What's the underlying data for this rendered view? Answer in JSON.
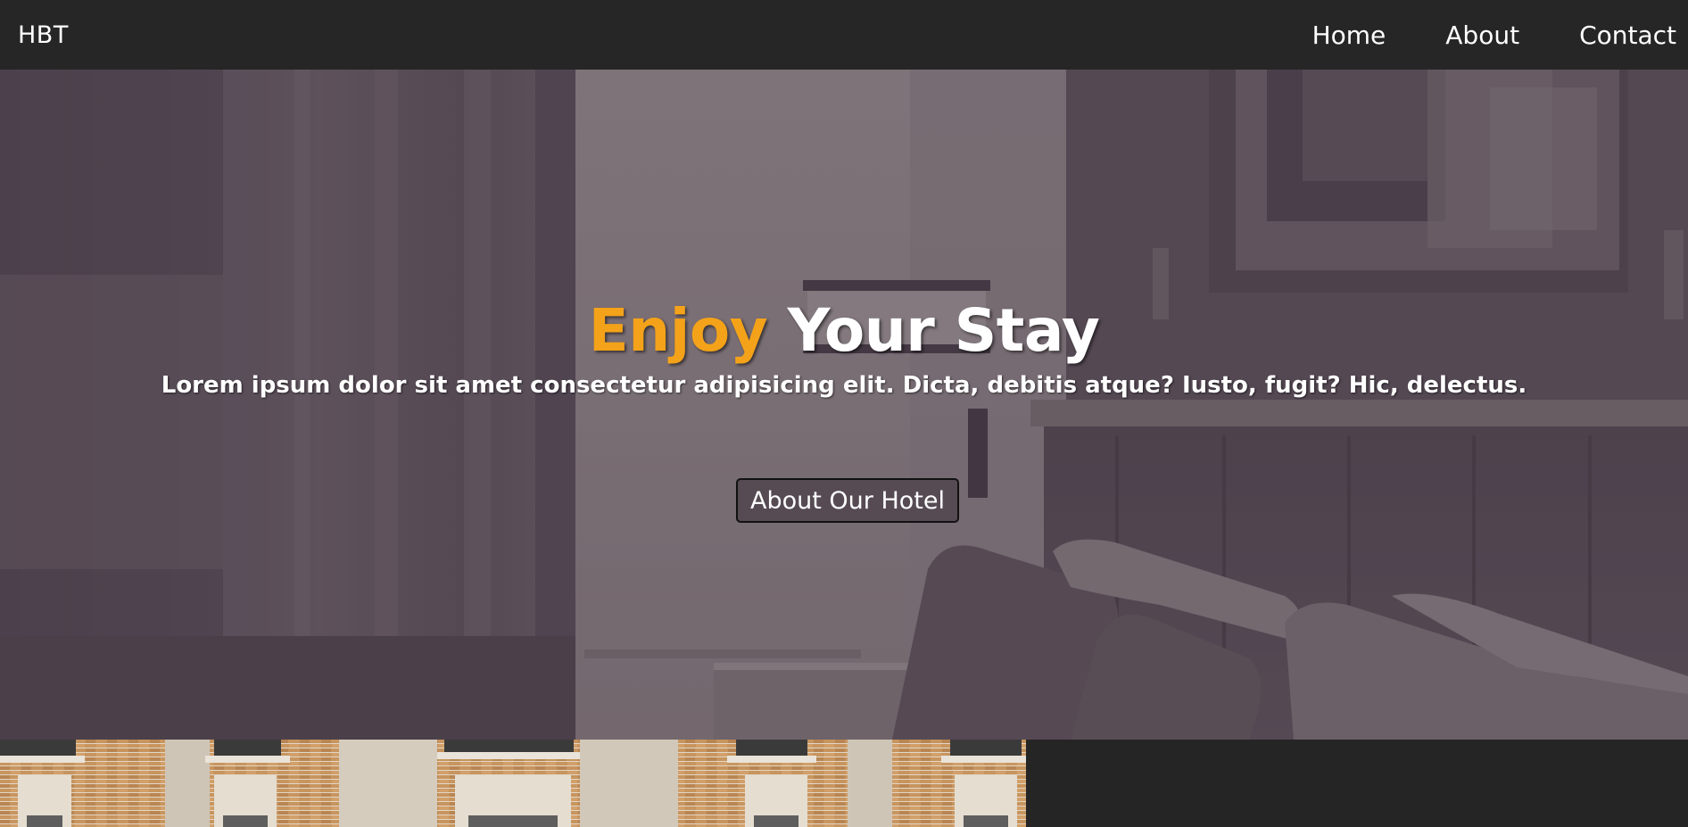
{
  "navbar": {
    "brand": "HBT",
    "links": [
      "Home",
      "About",
      "Contact"
    ]
  },
  "hero": {
    "title_accent": "Enjoy",
    "title_rest": "Your Stay",
    "subtitle": "Lorem ipsum dolor sit amet consectetur adipisicing elit. Dicta, debitis atque? Iusto, fugit? Hic, delectus.",
    "button_label": "About Our Hotel"
  },
  "colors": {
    "navbar_bg": "#262626",
    "accent": "#f3a21a",
    "text": "#ffffff",
    "page_bg": "#252525"
  }
}
